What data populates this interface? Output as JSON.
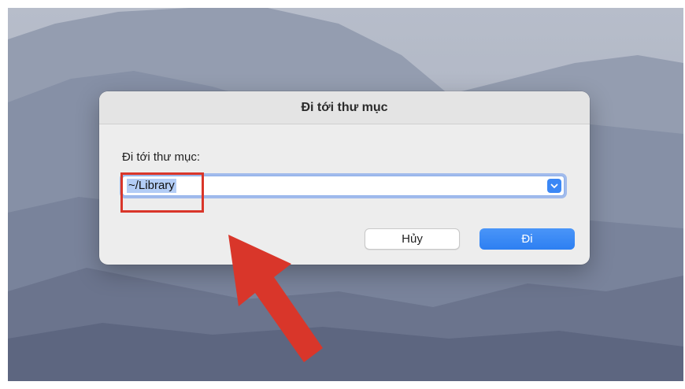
{
  "dialog": {
    "title": "Đi tới thư mục",
    "prompt_label": "Đi tới thư mục:",
    "path_value": "~/Library",
    "cancel_label": "Hủy",
    "go_label": "Đi"
  },
  "icons": {
    "combo_arrow": "chevron-down-icon",
    "annotation_arrow": "arrow-up-left-icon"
  },
  "colors": {
    "accent": "#3b87f5",
    "highlight": "#d9362a",
    "selection": "#b3cdf6"
  }
}
